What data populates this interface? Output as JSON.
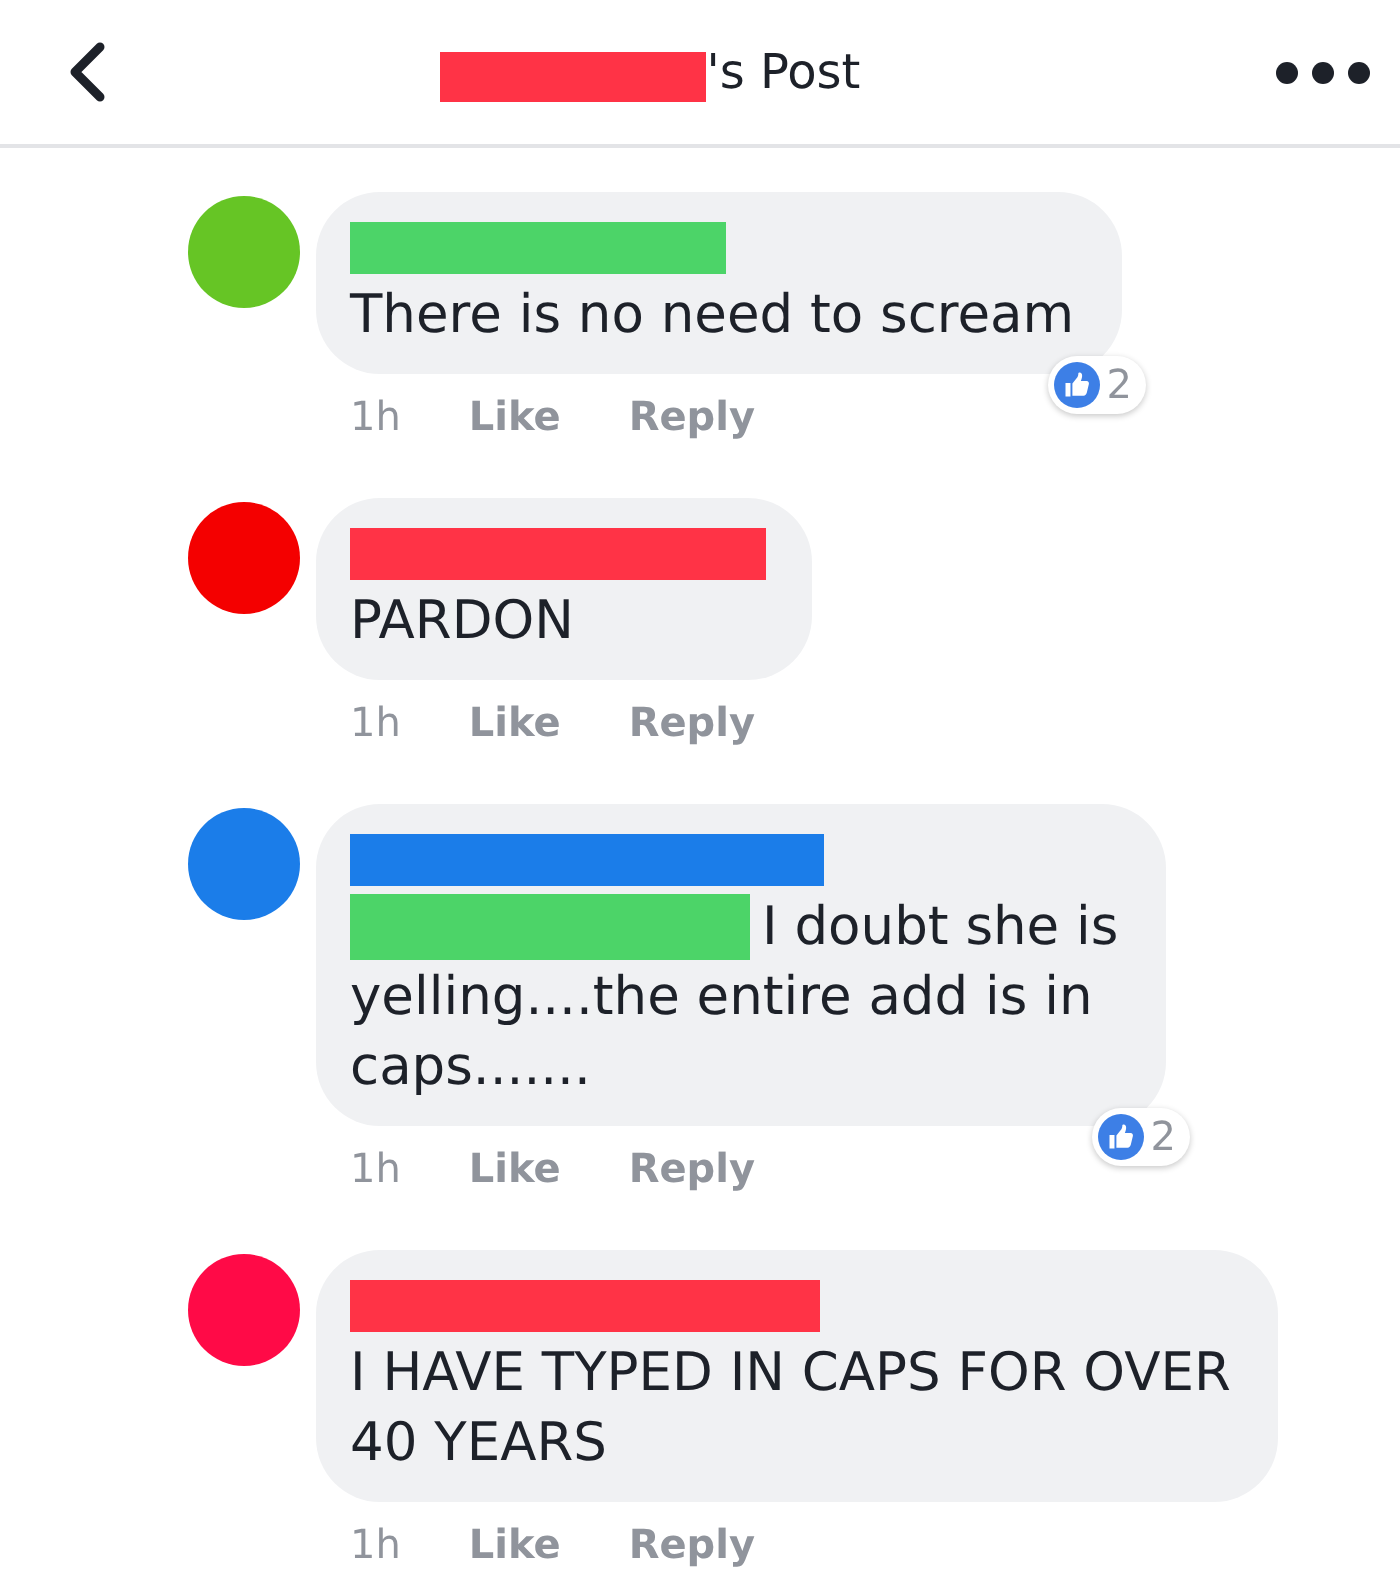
{
  "header": {
    "title": "'s Post"
  },
  "comments": [
    {
      "avatar": {
        "color": "#66c525"
      },
      "name_bar": {
        "color": "#4cd468"
      },
      "mention_redacted": false,
      "text": "There is no need to scream",
      "time": "1h",
      "actions": [
        "Like",
        "Reply"
      ],
      "reaction_count": "2"
    },
    {
      "avatar": {
        "color": "#f40000"
      },
      "name_bar": {
        "color": "#ff3346"
      },
      "mention_redacted": false,
      "text": "PARDON",
      "time": "1h",
      "actions": [
        "Like",
        "Reply"
      ]
    },
    {
      "avatar": {
        "color": "#1b7de9"
      },
      "name_bar": {
        "color": "#1b7de9"
      },
      "mention_redacted": true,
      "text": "I doubt she is yelling....the entire add is in caps.......",
      "time": "1h",
      "actions": [
        "Like",
        "Reply"
      ],
      "reaction_count": "2"
    },
    {
      "avatar": {
        "color": "#ff0a47"
      },
      "name_bar": {
        "color": "#ff3346"
      },
      "mention_redacted": false,
      "text": "I HAVE TYPED IN CAPS FOR OVER 40 YEARS",
      "time": "1h",
      "actions": [
        "Like",
        "Reply"
      ]
    }
  ]
}
